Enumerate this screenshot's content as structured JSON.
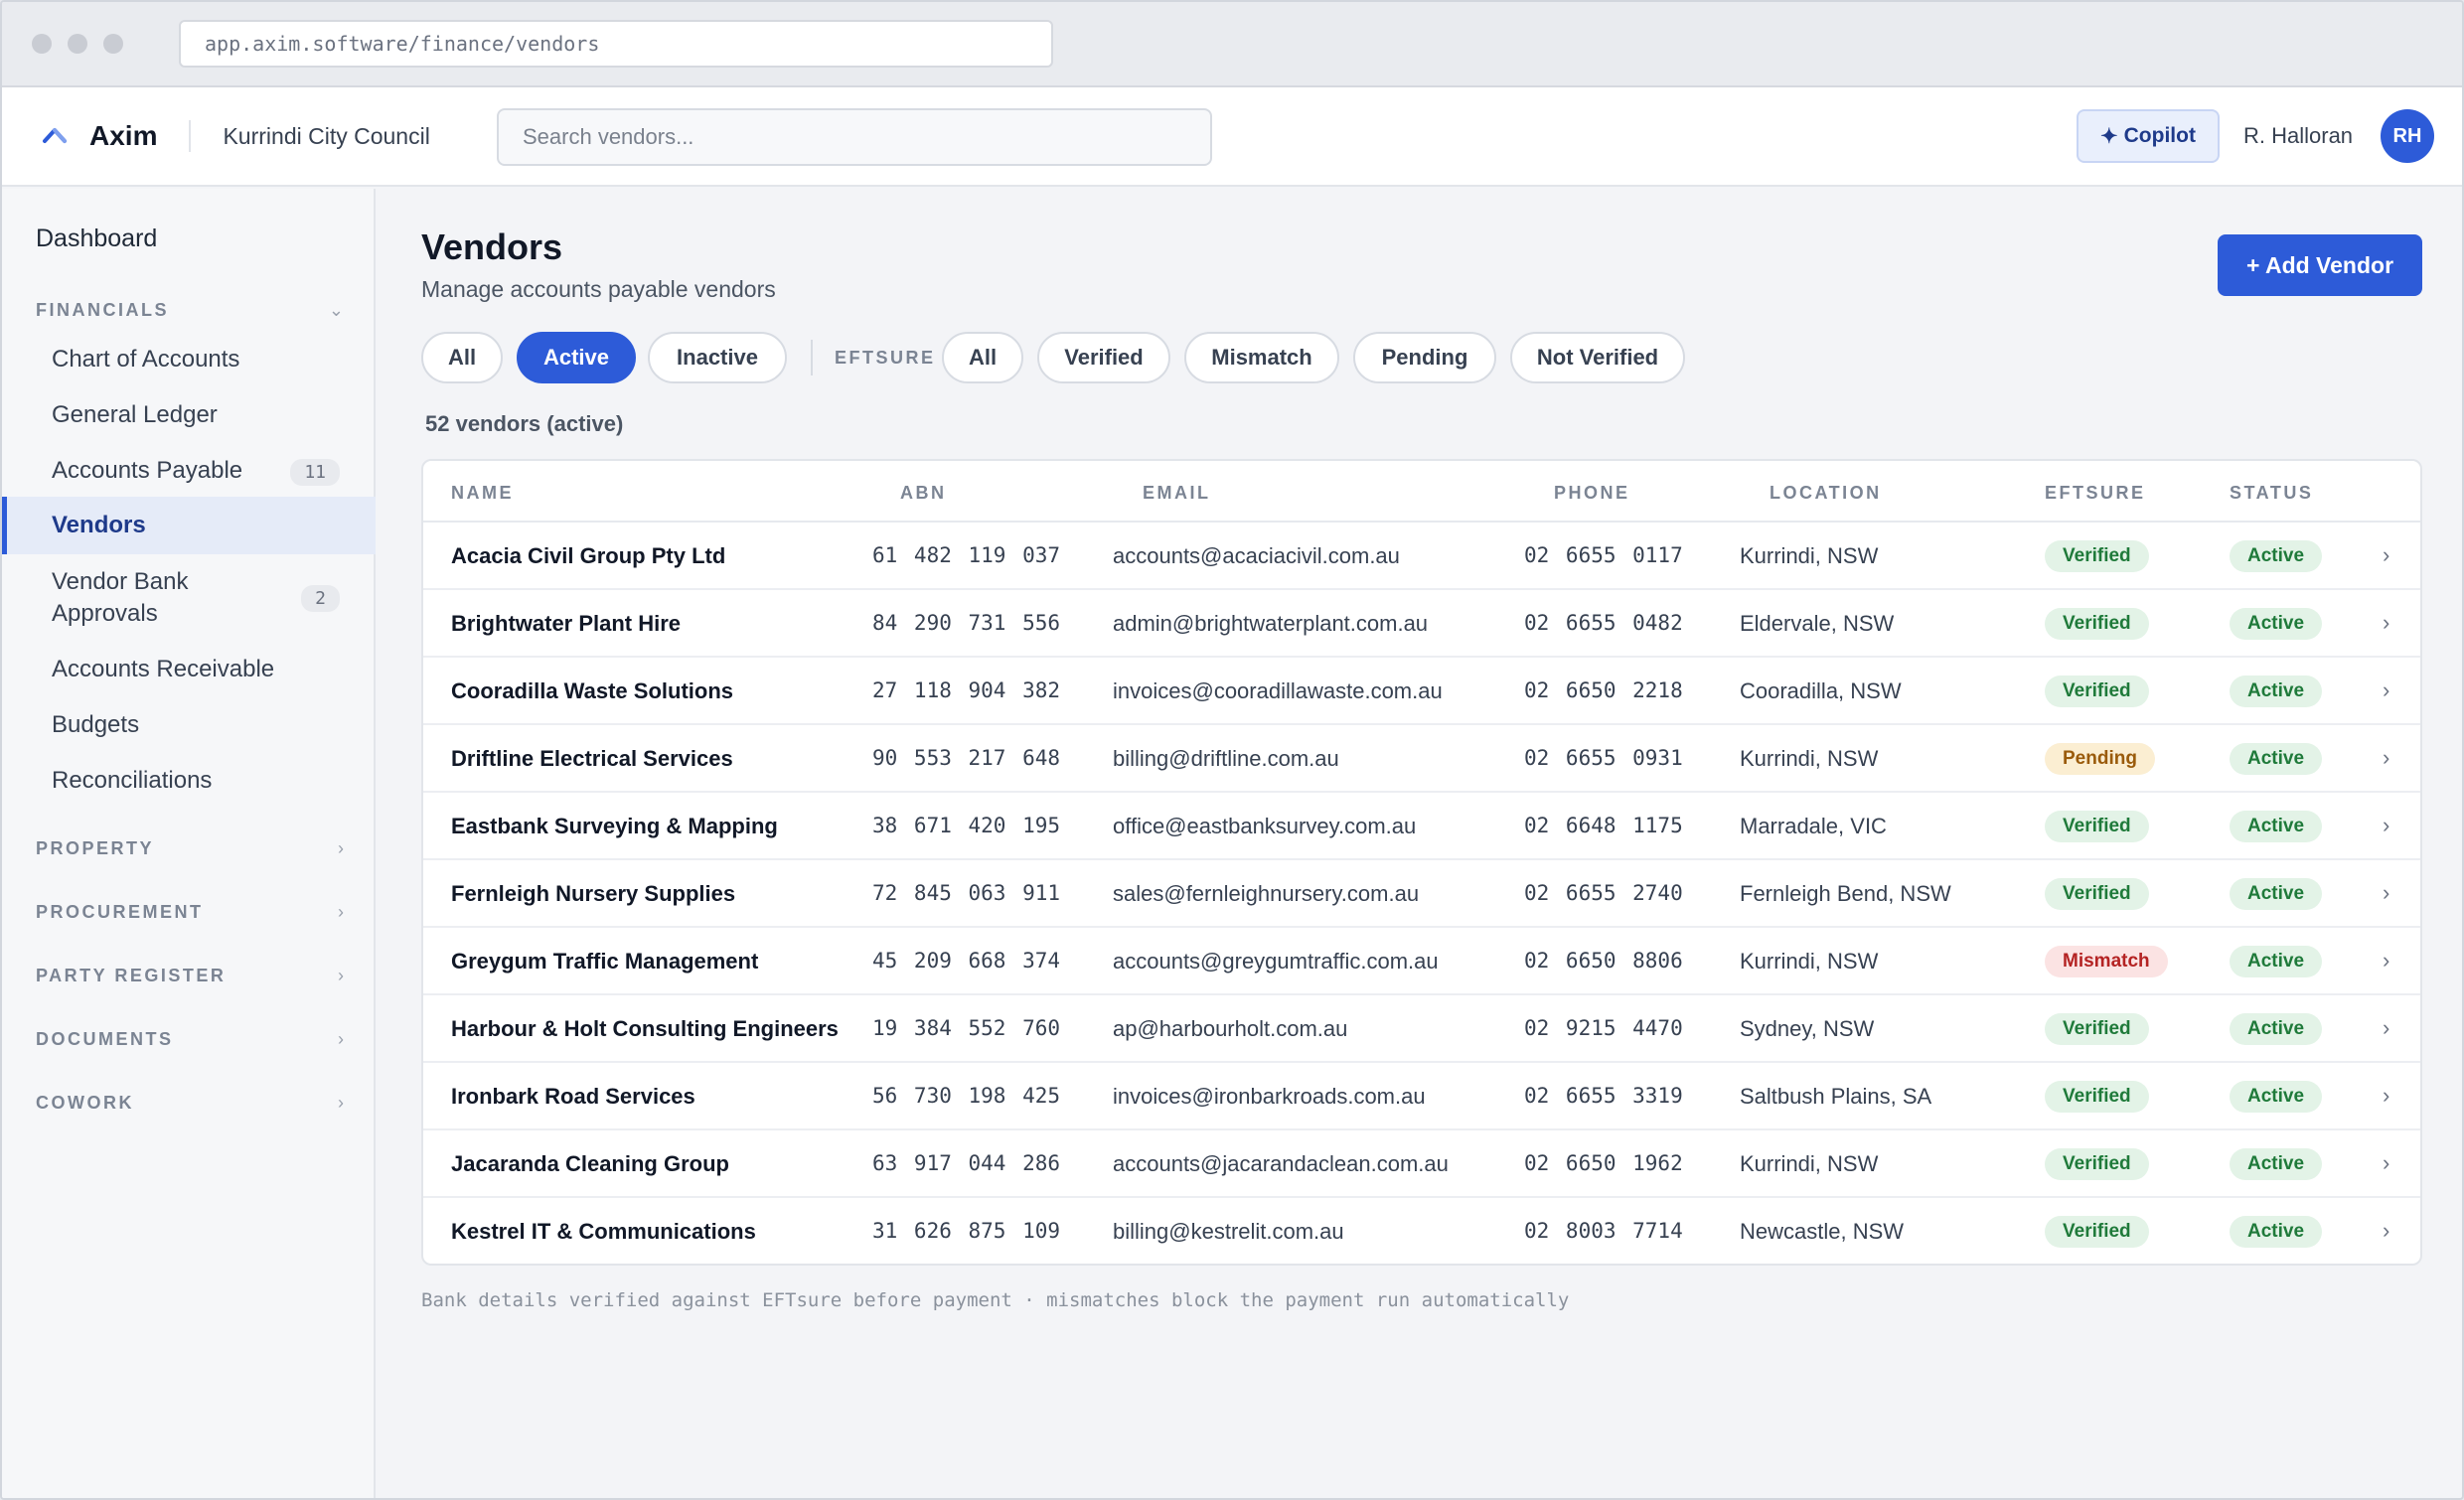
{
  "browser": {
    "url": "app.axim.software/finance/vendors"
  },
  "header": {
    "app_name": "Axim",
    "org_name": "Kurrindi City Council",
    "search_placeholder": "Search vendors...",
    "copilot_label": "Copilot",
    "user_name": "R. Halloran",
    "user_initials": "RH"
  },
  "sidebar": {
    "dashboard": "Dashboard",
    "financials_label": "FINANCIALS",
    "financials_items": [
      {
        "label": "Chart of Accounts"
      },
      {
        "label": "General Ledger"
      },
      {
        "label": "Accounts Payable",
        "badge": "11"
      },
      {
        "label": "Vendors"
      },
      {
        "label": "Vendor Bank Approvals",
        "badge": "2"
      },
      {
        "label": "Accounts Receivable"
      },
      {
        "label": "Budgets"
      },
      {
        "label": "Reconciliations"
      }
    ],
    "sections": [
      "PROPERTY",
      "PROCUREMENT",
      "PARTY REGISTER",
      "DOCUMENTS",
      "COWORK"
    ],
    "active_item": "Vendors"
  },
  "page": {
    "title": "Vendors",
    "subtitle": "Manage accounts payable vendors",
    "add_button": "+ Add Vendor",
    "status_filters": [
      "All",
      "Active",
      "Inactive"
    ],
    "active_status_filter": "Active",
    "eftsure_label": "EFTSURE",
    "eftsure_filters": [
      "All",
      "Verified",
      "Mismatch",
      "Pending",
      "Not Verified"
    ],
    "count_text": "52 vendors (active)",
    "footnote": "Bank details verified against EFTsure before payment · mismatches block the payment run automatically"
  },
  "table": {
    "columns": [
      "NAME",
      "ABN",
      "EMAIL",
      "PHONE",
      "LOCATION",
      "EFTSURE",
      "STATUS"
    ],
    "rows": [
      {
        "name": "Acacia Civil Group Pty Ltd",
        "abn": "61 482 119 037",
        "email": "accounts@acaciacivil.com.au",
        "phone": "02 6655 0117",
        "location": "Kurrindi, NSW",
        "eftsure": "Verified",
        "status": "Active"
      },
      {
        "name": "Brightwater Plant Hire",
        "abn": "84 290 731 556",
        "email": "admin@brightwaterplant.com.au",
        "phone": "02 6655 0482",
        "location": "Eldervale, NSW",
        "eftsure": "Verified",
        "status": "Active"
      },
      {
        "name": "Cooradilla Waste Solutions",
        "abn": "27 118 904 382",
        "email": "invoices@cooradillawaste.com.au",
        "phone": "02 6650 2218",
        "location": "Cooradilla, NSW",
        "eftsure": "Verified",
        "status": "Active"
      },
      {
        "name": "Driftline Electrical Services",
        "abn": "90 553 217 648",
        "email": "billing@driftline.com.au",
        "phone": "02 6655 0931",
        "location": "Kurrindi, NSW",
        "eftsure": "Pending",
        "status": "Active"
      },
      {
        "name": "Eastbank Surveying & Mapping",
        "abn": "38 671 420 195",
        "email": "office@eastbanksurvey.com.au",
        "phone": "02 6648 1175",
        "location": "Marradale, VIC",
        "eftsure": "Verified",
        "status": "Active"
      },
      {
        "name": "Fernleigh Nursery Supplies",
        "abn": "72 845 063 911",
        "email": "sales@fernleighnursery.com.au",
        "phone": "02 6655 2740",
        "location": "Fernleigh Bend, NSW",
        "eftsure": "Verified",
        "status": "Active"
      },
      {
        "name": "Greygum Traffic Management",
        "abn": "45 209 668 374",
        "email": "accounts@greygumtraffic.com.au",
        "phone": "02 6650 8806",
        "location": "Kurrindi, NSW",
        "eftsure": "Mismatch",
        "status": "Active"
      },
      {
        "name": "Harbour & Holt Consulting Engineers",
        "abn": "19 384 552 760",
        "email": "ap@harbourholt.com.au",
        "phone": "02 9215 4470",
        "location": "Sydney, NSW",
        "eftsure": "Verified",
        "status": "Active"
      },
      {
        "name": "Ironbark Road Services",
        "abn": "56 730 198 425",
        "email": "invoices@ironbarkroads.com.au",
        "phone": "02 6655 3319",
        "location": "Saltbush Plains, SA",
        "eftsure": "Verified",
        "status": "Active"
      },
      {
        "name": "Jacaranda Cleaning Group",
        "abn": "63 917 044 286",
        "email": "accounts@jacarandaclean.com.au",
        "phone": "02 6650 1962",
        "location": "Kurrindi, NSW",
        "eftsure": "Verified",
        "status": "Active"
      },
      {
        "name": "Kestrel IT & Communications",
        "abn": "31 626 875 109",
        "email": "billing@kestrelit.com.au",
        "phone": "02 8003 7714",
        "location": "Newcastle, NSW",
        "eftsure": "Verified",
        "status": "Active"
      }
    ]
  },
  "colors": {
    "accent": "#2d5bd8",
    "verified": "#1f7a3a",
    "pending": "#9a5b0b",
    "mismatch": "#b42323"
  }
}
